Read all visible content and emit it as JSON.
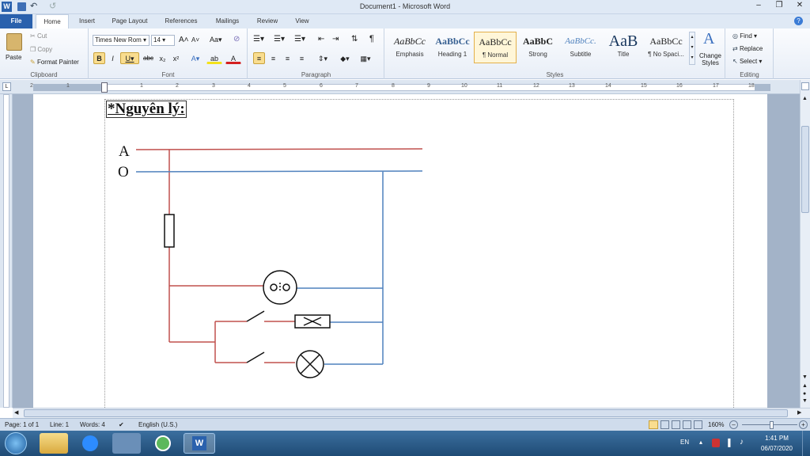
{
  "window": {
    "title": "Document1  -  Microsoft Word"
  },
  "tabs": [
    "File",
    "Home",
    "Insert",
    "Page Layout",
    "References",
    "Mailings",
    "Review",
    "View"
  ],
  "clipboard": {
    "paste": "Paste",
    "cut": "Cut",
    "copy": "Copy",
    "format_painter": "Format Painter",
    "label": "Clipboard"
  },
  "font": {
    "name": "Times New Rom",
    "size": "14",
    "label": "Font"
  },
  "paragraph": {
    "label": "Paragraph"
  },
  "styles": {
    "items": [
      {
        "preview": "AaBbCc",
        "name": "Emphasis"
      },
      {
        "preview": "AaBbCc",
        "name": "Heading 1"
      },
      {
        "preview": "AaBbCc",
        "name": "¶ Normal"
      },
      {
        "preview": "AaBbC",
        "name": "Strong"
      },
      {
        "preview": "AaBbCc.",
        "name": "Subtitle"
      },
      {
        "preview": "AaB",
        "name": "Title"
      },
      {
        "preview": "AaBbCc",
        "name": "¶ No Spaci..."
      }
    ],
    "change": "Change Styles",
    "label": "Styles"
  },
  "editing": {
    "find": "Find",
    "replace": "Replace",
    "select": "Select",
    "label": "Editing"
  },
  "ruler_numbers": [
    "1",
    "2",
    "1",
    "2",
    "3",
    "4",
    "5",
    "6",
    "7",
    "8",
    "9",
    "10",
    "11",
    "12",
    "13",
    "14",
    "15",
    "16",
    "17",
    "18"
  ],
  "document": {
    "heading": "*Nguyên lý:",
    "label_a": "A",
    "label_o": "O"
  },
  "status": {
    "page": "Page: 1 of 1",
    "line": "Line: 1",
    "words": "Words: 4",
    "language": "English (U.S.)",
    "zoom": "160%"
  },
  "taskbar": {
    "lang": "EN",
    "time": "1:41 PM",
    "date": "06/07/2020"
  },
  "colors": {
    "phase": "#c0504d",
    "neutral": "#4f81bd",
    "file_tab": "#2a61ad"
  }
}
